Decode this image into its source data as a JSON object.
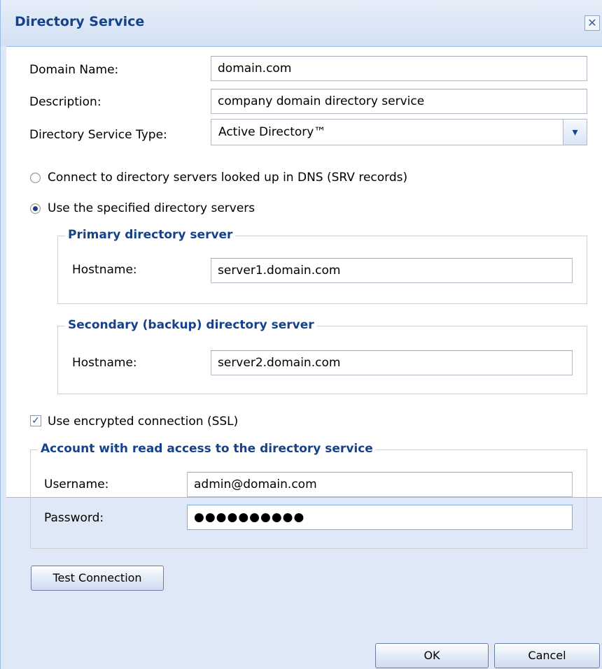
{
  "dialog": {
    "title": "Directory Service",
    "close_glyph": "✕"
  },
  "form": {
    "domain_name": {
      "label": "Domain Name:",
      "value": "domain.com"
    },
    "description": {
      "label": "Description:",
      "value": "company domain directory service"
    },
    "service_type": {
      "label": "Directory Service Type:",
      "value": "Active Directory™",
      "arrow_glyph": "▾"
    }
  },
  "connection": {
    "dns_option": {
      "label": "Connect to directory servers looked up in DNS (SRV records)",
      "selected": false
    },
    "specified_option": {
      "label": "Use the specified directory servers",
      "selected": true
    }
  },
  "primary_server": {
    "legend": "Primary directory server",
    "hostname_label": "Hostname:",
    "hostname_value": "server1.domain.com"
  },
  "secondary_server": {
    "legend": "Secondary (backup) directory server",
    "hostname_label": "Hostname:",
    "hostname_value": "server2.domain.com"
  },
  "ssl": {
    "label": "Use encrypted connection (SSL)",
    "checked": true,
    "check_glyph": "✓"
  },
  "account": {
    "legend": "Account with read access to the directory service",
    "username_label": "Username:",
    "username_value": "admin@domain.com",
    "password_label": "Password:",
    "password_value": "●●●●●●●●●●"
  },
  "buttons": {
    "test_connection": "Test Connection",
    "ok": "OK",
    "cancel": "Cancel"
  }
}
